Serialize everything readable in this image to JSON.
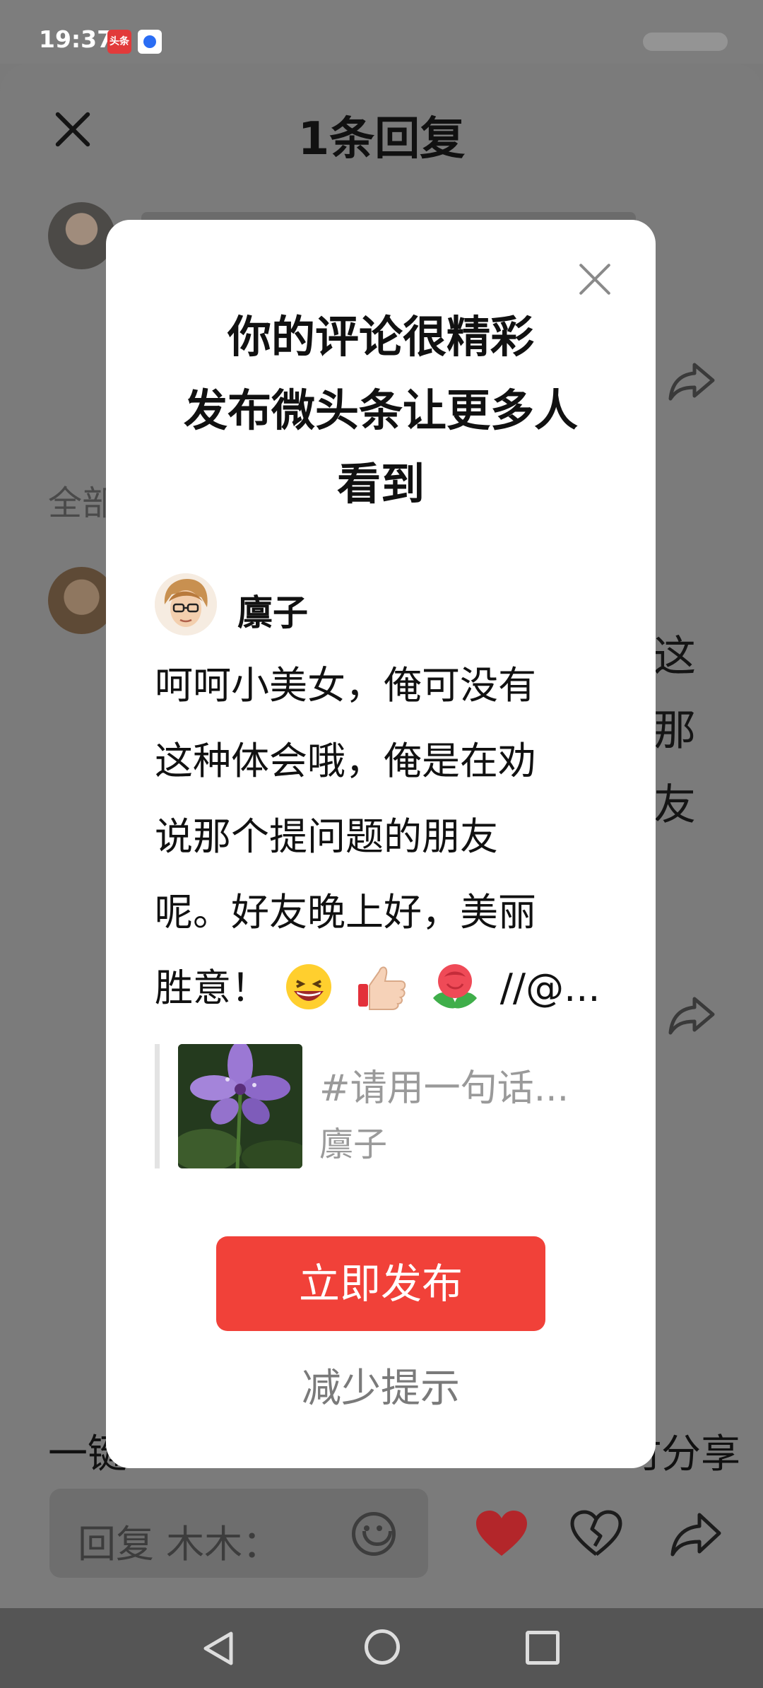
{
  "status_bar": {
    "time": "19:37",
    "toutiao_badge": "头条"
  },
  "sheet": {
    "title": "1条回复",
    "all_label": "全部",
    "right_chars": [
      "这",
      "那",
      "友"
    ],
    "bottom_left_text": "一键",
    "bottom_right_text": "时分享"
  },
  "modal": {
    "title_lines": [
      "你的评论很精彩",
      "发布微头条让更多人",
      "看到"
    ],
    "author_name": "廪子",
    "comment_lines": [
      "呵呵小美女，俺可没有",
      "这种体会哦，俺是在劝",
      "说那个提问题的朋友",
      "呢。好友晚上好，美丽",
      "胜意！"
    ],
    "comment_tail": "//@...",
    "emojis": [
      "laughing-emoji",
      "thumbs-up-emoji",
      "rose-emoji"
    ],
    "quote": {
      "title": "#请用一句话...",
      "author": "廪子"
    },
    "publish_label": "立即发布",
    "reduce_label": "减少提示"
  },
  "reply_bar": {
    "placeholder": "回复 木木："
  },
  "colors": {
    "accent": "#f14139",
    "like_red": "#d3262e",
    "overlay": "#7b7b7b"
  }
}
